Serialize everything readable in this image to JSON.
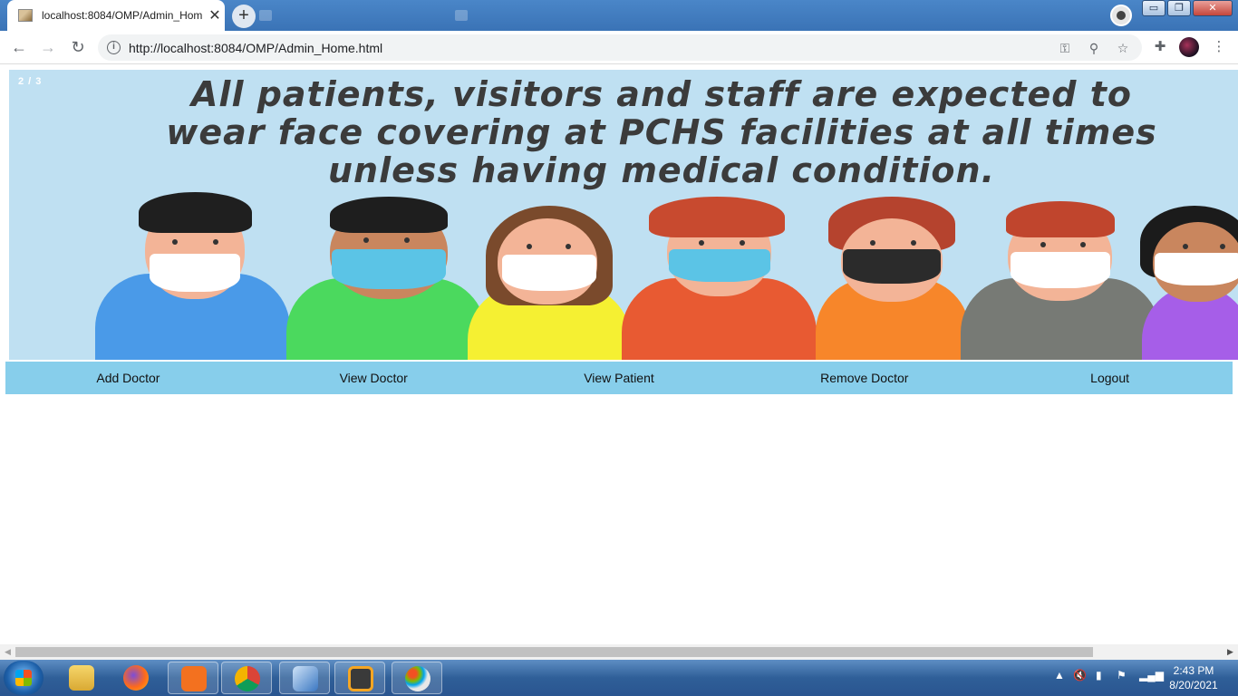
{
  "browser": {
    "active_tab_title": "localhost:8084/OMP/Admin_Hom",
    "url": "http://localhost:8084/OMP/Admin_Home.html",
    "window_controls": {
      "minimize": "▭",
      "maximize": "❐",
      "close": "✕"
    }
  },
  "page": {
    "slide_counter": "2 / 3",
    "banner_lines": [
      "All patients, visitors and staff are expected to",
      "wear face covering at PCHS facilities at all times",
      "unless having medical condition."
    ],
    "nav_items": [
      "Add Doctor",
      "View Doctor",
      "View Patient",
      "Remove Doctor",
      "Logout"
    ],
    "menu_color": "#87ceeb"
  },
  "taskbar": {
    "apps": [
      "file-explorer",
      "firefox",
      "xampp",
      "chrome",
      "virtualbox",
      "sublime-text",
      "paint"
    ],
    "time": "2:43 PM",
    "date": "8/20/2021"
  }
}
